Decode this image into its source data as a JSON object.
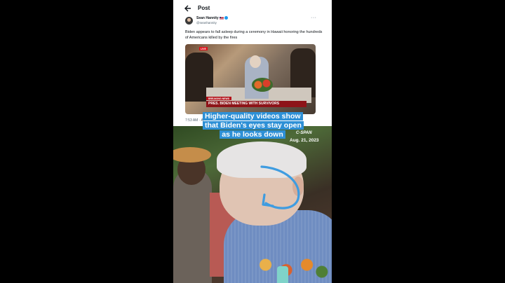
{
  "post": {
    "header_title": "Post",
    "author_name": "Sean Hannity",
    "author_handle": "@seanhannity",
    "text": "Biden appears to fall asleep during a ceremony in Hawaii honoring the hundreds of Americans killed by the fires",
    "meta": "7:53 AM · A",
    "icons": {
      "back": "back-arrow-icon",
      "more": "more-options-icon",
      "verified": "verified-badge-icon",
      "flag": "us-flag-icon"
    },
    "media": {
      "live_badge": "LIVE",
      "breaking_tag": "BREAKING NEWS",
      "chyron": "PRES. BIDEN MEETING WITH SURVIVORS"
    }
  },
  "video": {
    "caption": "Higher-quality videos show that Biden's eyes stay open as he looks down",
    "source": "C-SPAN",
    "date": "Aug. 21, 2023"
  },
  "colors": {
    "caption_bg": "#2e90d6",
    "arrow": "#3f9ce0",
    "verified": "#1d9bf0",
    "chyron": "#8d1419"
  }
}
